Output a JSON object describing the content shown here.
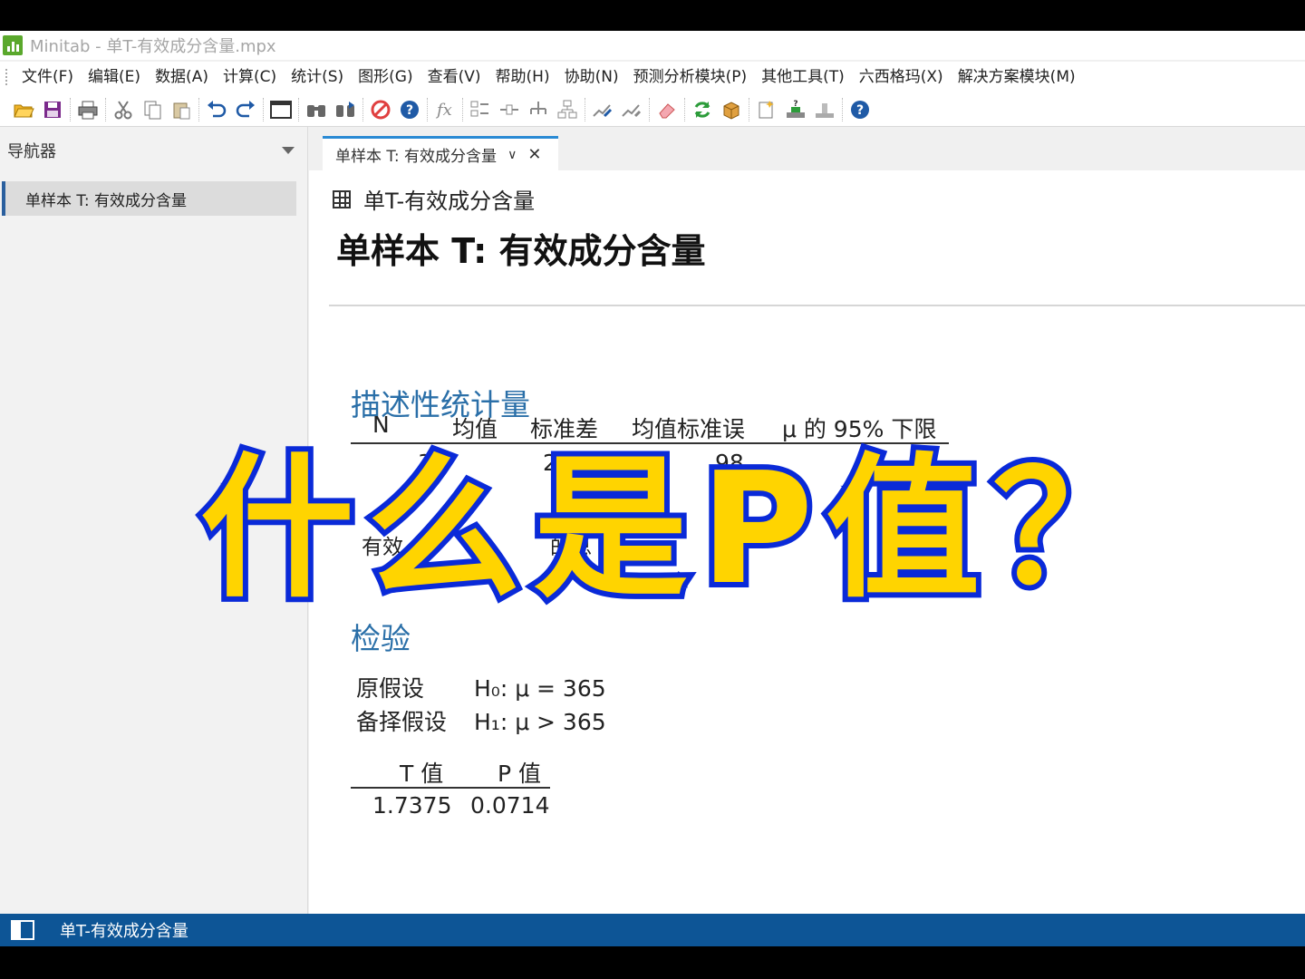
{
  "window": {
    "title": "Minitab - 单T-有效成分含量.mpx",
    "logo_icon": "minitab-bar-chart-icon",
    "accent_color": "#5aa82c"
  },
  "menu": [
    {
      "label": "文件(F)"
    },
    {
      "label": "编辑(E)"
    },
    {
      "label": "数据(A)"
    },
    {
      "label": "计算(C)"
    },
    {
      "label": "统计(S)"
    },
    {
      "label": "图形(G)"
    },
    {
      "label": "查看(V)"
    },
    {
      "label": "帮助(H)"
    },
    {
      "label": "协助(N)"
    },
    {
      "label": "预测分析模块(P)"
    },
    {
      "label": "其他工具(T)"
    },
    {
      "label": "六西格玛(X)"
    },
    {
      "label": "解决方案模块(M)"
    }
  ],
  "toolbar": {
    "icons": [
      "open-icon",
      "save-icon",
      "print-icon",
      "cut-icon",
      "copy-icon",
      "paste-icon",
      "undo-icon",
      "redo-icon",
      "window-icon",
      "find-icon",
      "find-next-icon",
      "cancel-icon",
      "help-icon",
      "formula-icon",
      "layout-icon",
      "align-icon",
      "tree-icon",
      "hierarchy-icon",
      "edit-graph-icon",
      "brush-icon",
      "eraser-icon",
      "refresh-icon",
      "cube-icon",
      "new-report-icon",
      "assistant-icon",
      "stats-icon",
      "help-circle-icon"
    ]
  },
  "navigator": {
    "title": "导航器",
    "items": [
      {
        "label": "单样本 T: 有效成分含量"
      }
    ]
  },
  "tabs": [
    {
      "label": "单样本 T: 有效成分含量"
    }
  ],
  "output": {
    "header": "单T-有效成分含量",
    "title": "单样本 T: 有效成分含量",
    "descriptive": {
      "title": "描述性统计量",
      "columns": [
        "N",
        "均值",
        "标准差",
        "均值标准误",
        "μ 的 95% 下限"
      ],
      "row_visible_fragments": [
        "36",
        "2.40",
        "98"
      ],
      "note_fragments": [
        "有效",
        "的总"
      ]
    },
    "test": {
      "title": "检验",
      "null_label": "原假设",
      "null_hyp": "H₀: μ = 365",
      "alt_label": "备择假设",
      "alt_hyp": "H₁: μ > 365",
      "columns": [
        "T 值",
        "P 值"
      ],
      "values": [
        "1.7375",
        "0.0714"
      ]
    }
  },
  "overlay": {
    "text": "什么是P值？",
    "fill_color": "#ffd400",
    "stroke_color": "#0a2ad8"
  },
  "statusbar": {
    "text": "单T-有效成分含量",
    "background": "#0d5596"
  }
}
